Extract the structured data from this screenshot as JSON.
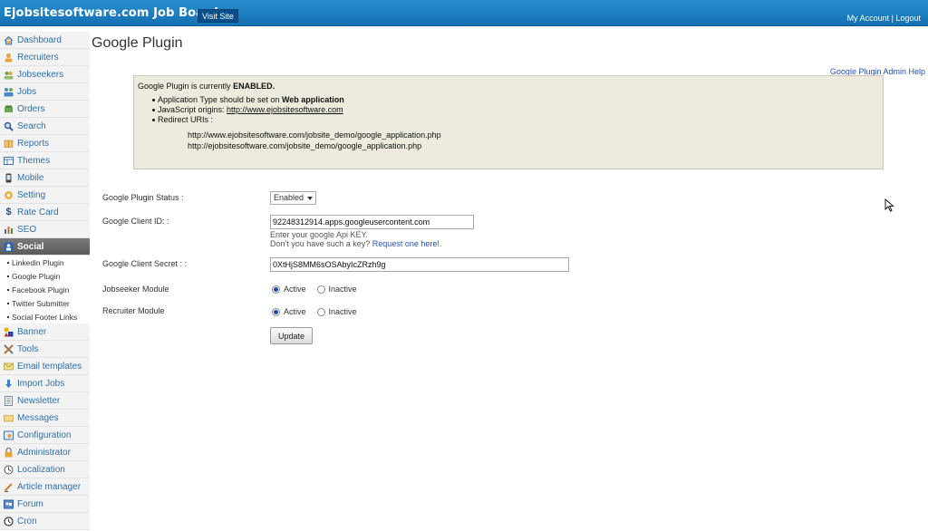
{
  "header": {
    "brand": "Ejobsitesoftware.com Job Board",
    "visit_site": "Visit Site",
    "my_account": "My Account",
    "separator": "|",
    "logout": "Logout"
  },
  "sidebar": {
    "items": [
      {
        "label": "Dashboard",
        "icon": "house-icon"
      },
      {
        "label": "Recruiters",
        "icon": "user-icon"
      },
      {
        "label": "Jobseekers",
        "icon": "users-icon"
      },
      {
        "label": "Jobs",
        "icon": "people-icon"
      },
      {
        "label": "Orders",
        "icon": "cart-icon"
      },
      {
        "label": "Search",
        "icon": "magnifier-icon"
      },
      {
        "label": "Reports",
        "icon": "book-icon"
      },
      {
        "label": "Themes",
        "icon": "grid-icon"
      },
      {
        "label": "Mobile",
        "icon": "phone-icon"
      },
      {
        "label": "Setting",
        "icon": "gear-icon"
      },
      {
        "label": "Rate Card",
        "icon": "dollar-icon"
      },
      {
        "label": "SEO",
        "icon": "chart-icon"
      },
      {
        "label": "Social",
        "icon": "share-icon"
      }
    ],
    "social_sub": [
      "Linkedin Plugin",
      "Google Plugin",
      "Facebook Plugin",
      "Twitter Submitter",
      "Social Footer Links"
    ],
    "items_after": [
      {
        "label": "Banner",
        "icon": "shapes-icon"
      },
      {
        "label": "Tools",
        "icon": "tools-icon"
      },
      {
        "label": "Email templates",
        "icon": "envelope-icon"
      },
      {
        "label": "Import Jobs",
        "icon": "download-icon"
      },
      {
        "label": "Newsletter",
        "icon": "document-icon"
      },
      {
        "label": "Messages",
        "icon": "mail-icon"
      },
      {
        "label": "Configuration",
        "icon": "config-icon"
      },
      {
        "label": "Administrator",
        "icon": "lock-icon"
      },
      {
        "label": "Localization",
        "icon": "globe-icon"
      },
      {
        "label": "Article manager",
        "icon": "pen-icon"
      },
      {
        "label": "Forum",
        "icon": "forum-icon"
      },
      {
        "label": "Cron",
        "icon": "clock-icon"
      }
    ]
  },
  "main": {
    "title": "Google Plugin",
    "help_link": "Google Plugin Admin Help",
    "info": {
      "status_prefix": "Google Plugin is currently ",
      "status_value": "ENABLED.",
      "bullet1_prefix": "Application Type should be set on ",
      "bullet1_value": "Web application",
      "bullet2_prefix": "JavaScript origins: ",
      "bullet2_link": "http://www.ejobsitesoftware.com",
      "bullet3": "Redirect URIs :",
      "uri1": "http://www.ejobsitesoftware.com/jobsite_demo/google_application.php",
      "uri2": "http://ejobsitesoftware.com/jobsite_demo/google_application.php"
    },
    "form": {
      "status_label": "Google Plugin Status :",
      "status_value": "Enabled",
      "client_id_label": "Google Client ID: :",
      "client_id_value": "92248312914.apps.googleusercontent.com",
      "client_id_hint1": "Enter your google Api KEY.",
      "client_id_hint2_prefix": "Don't you have such a key? ",
      "client_id_hint2_link": "Request one here!",
      "client_id_hint2_suffix": ".",
      "secret_label": "Google Client Secret : :",
      "secret_value": "0XtHjS8MM6sOSAbyIcZRzh9g",
      "jobseeker_label": "Jobseeker Module",
      "recruiter_label": "Recruiter Module",
      "active": "Active",
      "inactive": "Inactive",
      "update": "Update"
    }
  }
}
